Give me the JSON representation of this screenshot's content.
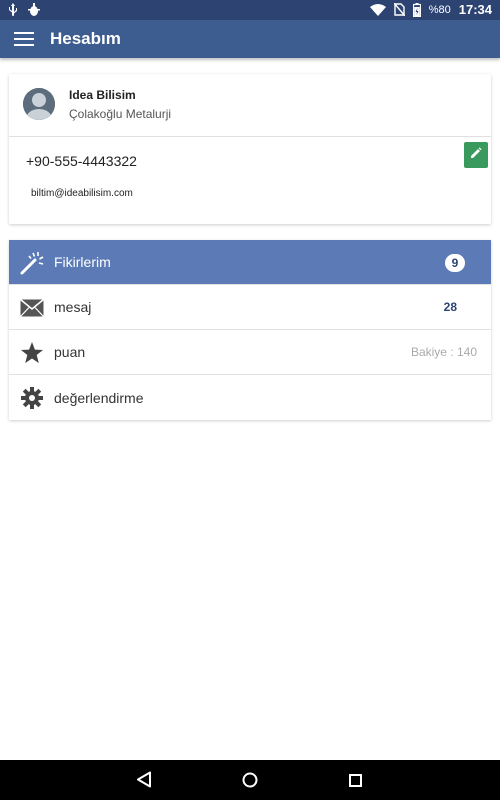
{
  "status_bar": {
    "battery": "%80",
    "time": "17:34",
    "icons": [
      "usb-icon",
      "android-debug-icon",
      "wifi-icon",
      "no-sim-icon",
      "battery-charging-icon"
    ]
  },
  "app_bar": {
    "title": "Hesabım",
    "menu_icon": "hamburger-menu-icon"
  },
  "profile": {
    "name": "Idea Bilisim",
    "company": "Çolakoğlu Metalurji",
    "phone": "+90-555-4443322",
    "email": "biltim@ideabilisim.com",
    "edit_icon": "pencil-icon"
  },
  "menu": {
    "items": [
      {
        "label": "Fikirlerim",
        "icon": "magic-wand-icon",
        "badge": "9",
        "active": true
      },
      {
        "label": "mesaj",
        "icon": "envelope-icon",
        "count": "28"
      },
      {
        "label": "puan",
        "icon": "star-icon",
        "balance": "Bakiye : 140"
      },
      {
        "label": "değerlendirme",
        "icon": "gear-icon"
      }
    ]
  },
  "colors": {
    "status_bar": "#2d4473",
    "app_bar": "#3d5c8f",
    "active_row": "#5b7ab6",
    "edit_button": "#3a9a5e"
  },
  "nav_bar": {
    "icons": [
      "back-icon",
      "home-icon",
      "recents-icon"
    ]
  }
}
